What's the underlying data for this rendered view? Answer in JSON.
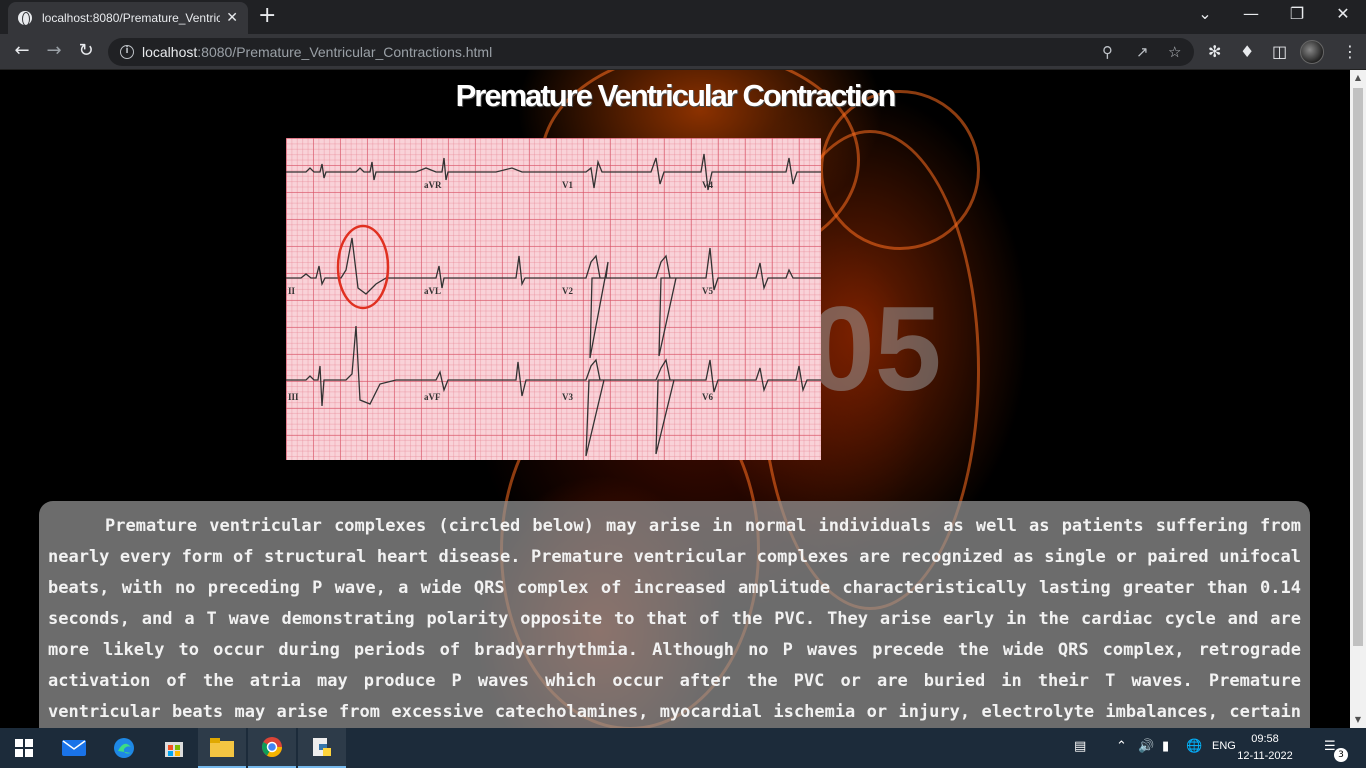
{
  "browser": {
    "tab_title": "localhost:8080/Premature_Ventric",
    "tab_close": "✕",
    "new_tab": "+",
    "url_host": "localhost",
    "url_rest": ":8080/Premature_Ventricular_Contractions.html",
    "window_controls": [
      "⌄",
      "—",
      "❐",
      "✕"
    ],
    "icons": [
      "back-arrow-icon",
      "forward-arrow-icon",
      "reload-icon",
      "info-icon",
      "zoom-icon",
      "share-icon",
      "star-icon",
      "extension-icon",
      "puzzle-icon",
      "sidebar-icon",
      "profile-avatar"
    ]
  },
  "page": {
    "title": "Premature Ventricular Contraction",
    "background_watermark": "05",
    "ecg_leads": [
      "aVR",
      "V1",
      "V4",
      "II",
      "aVL",
      "V2",
      "V5",
      "III",
      "aVF",
      "V3",
      "V6"
    ],
    "description": "Premature ventricular complexes (circled below) may arise in normal individuals as well as patients suffering from nearly every form of structural heart disease. Premature ventricular complexes are recognized as single or paired unifocal beats, with no preceding P wave, a wide QRS complex of increased amplitude characteristically lasting greater than 0.14 seconds, and a T wave demonstrating polarity opposite to that of the PVC. They arise early in the cardiac cycle and are more likely to occur during periods of bradyarrhythmia. Although no P waves precede the wide QRS complex, retrograde activation of the atria may produce P waves which occur after the PVC or are buried in their T waves. Premature ventricular beats may arise from excessive catecholamines, myocardial ischemia or injury, electrolyte imbalances, certain medications including digitalis and"
  },
  "taskbar": {
    "apps": [
      "windows-start-icon",
      "mail-icon",
      "edge-icon",
      "store-icon",
      "file-explorer-icon",
      "chrome-icon",
      "python-icon"
    ],
    "language": "ENG",
    "time": "09:58",
    "date": "12-11-2022",
    "notification_count": "3"
  },
  "colors": {
    "chrome_dark": "#202124",
    "toolbar": "#35363a",
    "ecg_paper": "#f9d2d8",
    "pvc_circle": "#e03020",
    "desc_box": "#969696",
    "taskbar": "#1c2b3a"
  }
}
